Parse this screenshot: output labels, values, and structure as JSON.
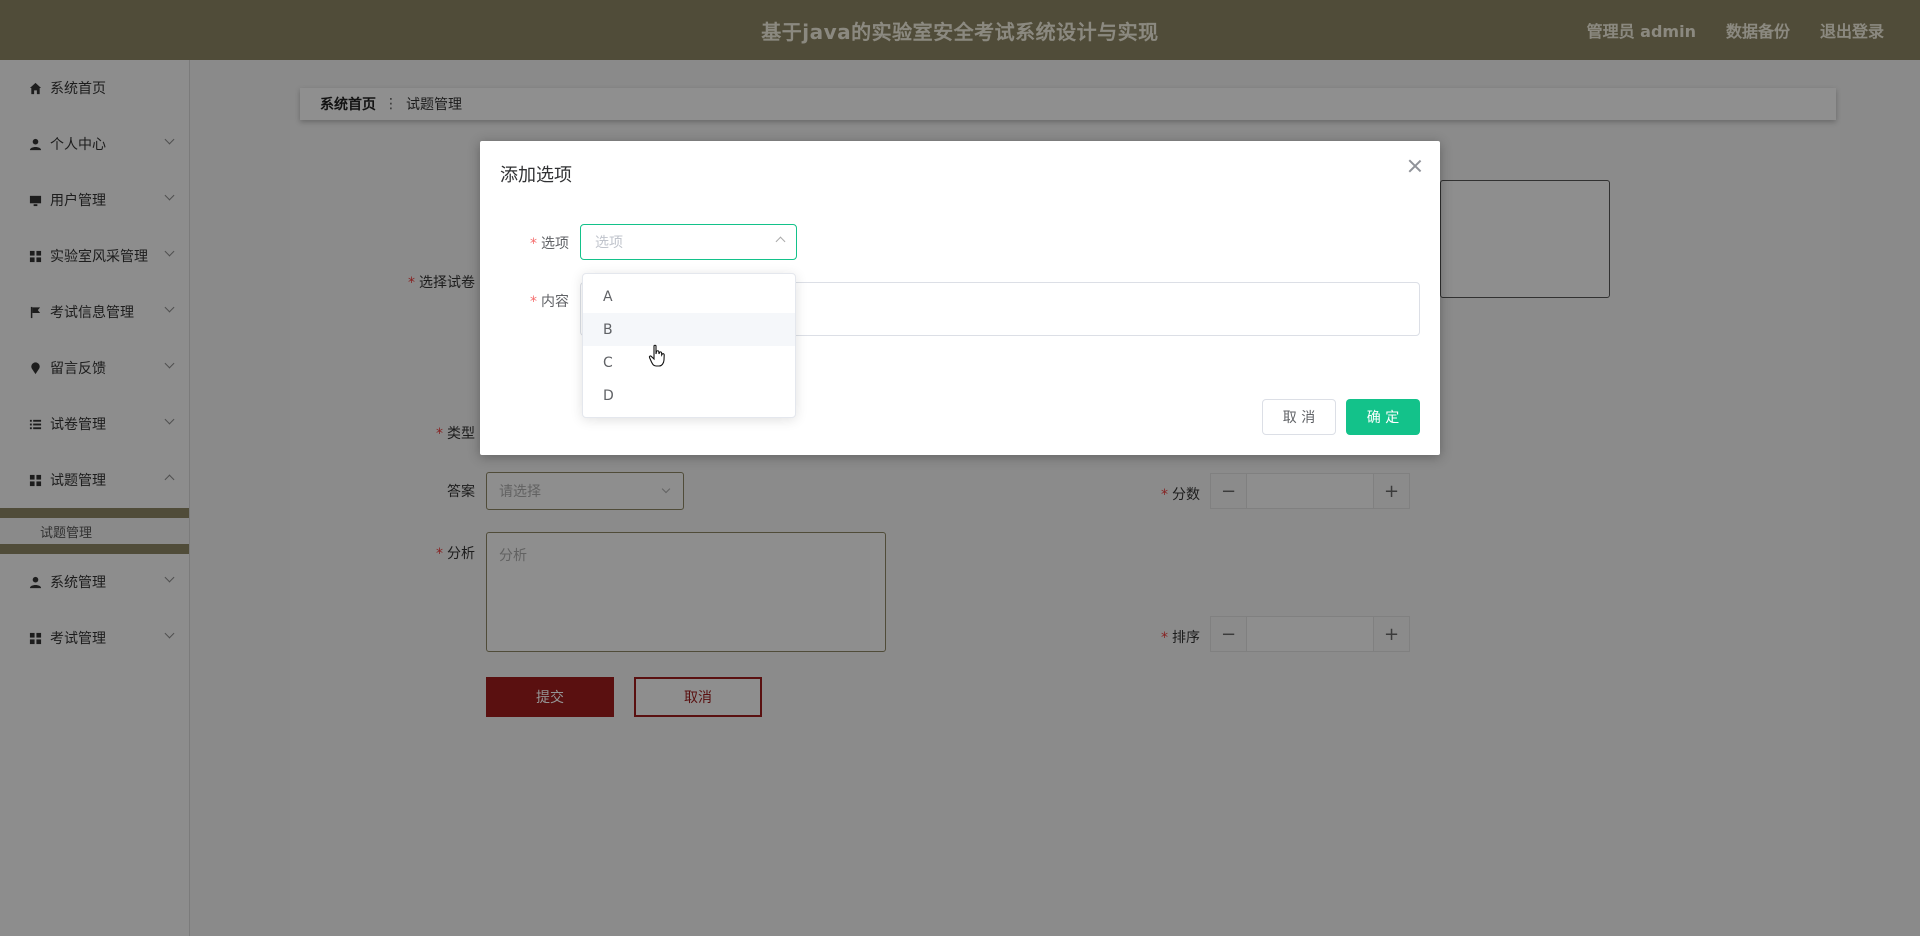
{
  "header": {
    "title": "基于java的实验室安全考试系统设计与实现",
    "admin": "管理员 admin",
    "backup": "数据备份",
    "logout": "退出登录"
  },
  "sidebar": {
    "items": [
      {
        "label": "系统首页",
        "icon": "home-icon"
      },
      {
        "label": "个人中心",
        "icon": "user-icon"
      },
      {
        "label": "用户管理",
        "icon": "monitor-icon"
      },
      {
        "label": "实验室风采管理",
        "icon": "grid-icon"
      },
      {
        "label": "考试信息管理",
        "icon": "flag-icon"
      },
      {
        "label": "留言反馈",
        "icon": "pin-icon"
      },
      {
        "label": "试卷管理",
        "icon": "list-icon"
      },
      {
        "label": "试题管理",
        "icon": "grid-icon"
      },
      {
        "label": "系统管理",
        "icon": "user-icon"
      },
      {
        "label": "考试管理",
        "icon": "grid-icon"
      }
    ],
    "submenu": {
      "label": "试题管理"
    }
  },
  "breadcrumb": {
    "home": "系统首页",
    "current": "试题管理"
  },
  "form": {
    "paper_label": "选择试卷",
    "type_label": "类型",
    "answer_label": "答案",
    "answer_placeholder": "请选择",
    "analysis_label": "分析",
    "analysis_placeholder": "分析",
    "score_label": "分数",
    "order_label": "排序",
    "submit_label": "提交",
    "cancel_label": "取消"
  },
  "dialog": {
    "title": "添加选项",
    "option_label": "选项",
    "option_placeholder": "选项",
    "content_label": "内容",
    "cancel_label": "取 消",
    "confirm_label": "确 定",
    "options": [
      "A",
      "B",
      "C",
      "D"
    ],
    "hovered_option": "B"
  },
  "colors": {
    "header_bg": "#8b8462",
    "primary_green": "#13c28a",
    "submit_red": "#9b1c1c"
  }
}
